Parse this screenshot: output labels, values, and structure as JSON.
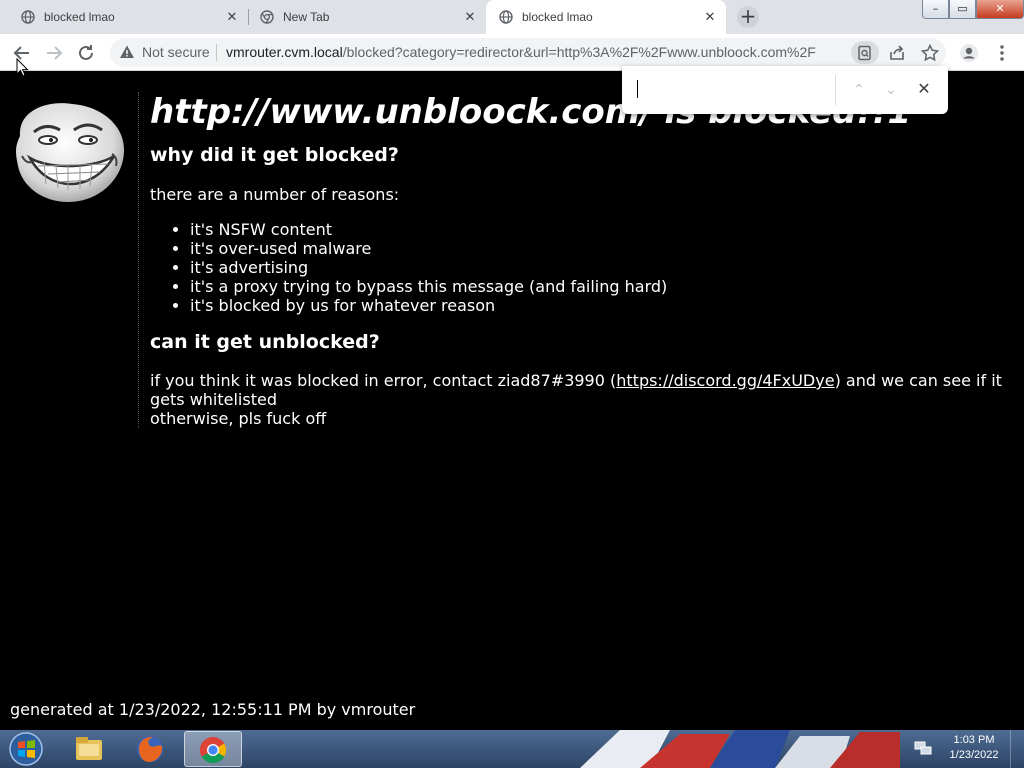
{
  "browser": {
    "tabs": [
      {
        "title": "blocked lmao",
        "active": false,
        "favicon": "globe-icon"
      },
      {
        "title": "New Tab",
        "active": false,
        "favicon": "chrome-icon"
      },
      {
        "title": "blocked lmao",
        "active": true,
        "favicon": "globe-icon"
      }
    ],
    "security_label": "Not secure",
    "url_host": "vmrouter.cvm.local",
    "url_path": "/blocked?category=redirector&url=http%3A%2F%2Fwww.unbloock.com%2F",
    "window_buttons": {
      "minimize": "–",
      "maximize": "▭",
      "close": "✕"
    }
  },
  "find_bar": {
    "value": "",
    "prev_label": "⌃",
    "next_label": "⌄",
    "close_label": "✕"
  },
  "page": {
    "headline": "http://www.unbloock.com/ is blocked!!1",
    "why_heading": "why did it get blocked?",
    "reasons_intro": "there are a number of reasons:",
    "reasons": [
      "it's NSFW content",
      "it's over-used malware",
      "it's advertising",
      "it's a proxy trying to bypass this message (and failing hard)",
      "it's blocked by us for whatever reason"
    ],
    "unblock_heading": "can it get unblocked?",
    "unblock_text_before": "if you think it was blocked in error, contact ziad87#3990 (",
    "unblock_link": "https://discord.gg/4FxUDye",
    "unblock_text_after": ") and we can see if it gets whitelisted",
    "closing_line": "otherwise, pls fuck off",
    "footer": "generated at 1/23/2022, 12:55:11 PM by vmrouter"
  },
  "taskbar": {
    "apps": [
      {
        "name": "file-explorer-icon",
        "active": false
      },
      {
        "name": "firefox-icon",
        "active": false
      },
      {
        "name": "chrome-icon",
        "active": true
      }
    ],
    "clock_time": "1:03 PM",
    "clock_date": "1/23/2022"
  },
  "colors": {
    "page_background": "#000000",
    "page_text": "#ffffff",
    "tabstrip": "#dee1e6",
    "taskbar": "#3a5578"
  }
}
